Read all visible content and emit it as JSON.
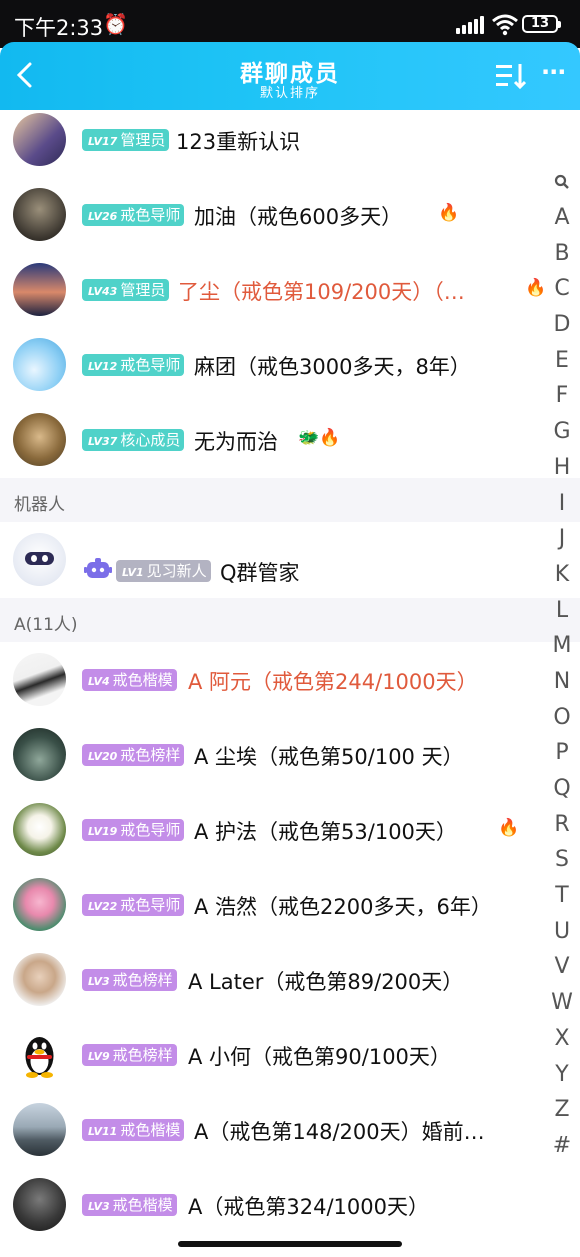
{
  "status_bar": {
    "time": "下午2:33",
    "battery": "13"
  },
  "header": {
    "back": "‹",
    "title": "群聊成员",
    "subtitle": "默认排序",
    "more": "···"
  },
  "sections": {
    "robot": "机器人",
    "a": "A(11人)"
  },
  "members": [
    {
      "level": "LV17",
      "role": "管理员",
      "name": "123重新认识",
      "emoji": ""
    },
    {
      "level": "LV26",
      "role": "戒色导师",
      "name": "加油（戒色600多天）",
      "emoji": "🔥"
    },
    {
      "level": "LV43",
      "role": "管理员",
      "name": "了尘（戒色第109/200天）（…",
      "emoji": "🔥"
    },
    {
      "level": "LV12",
      "role": "戒色导师",
      "name": "麻团（戒色3000多天，8年）",
      "emoji": ""
    },
    {
      "level": "LV37",
      "role": "核心成员",
      "name": "无为而治",
      "emoji": "🐲🔥"
    },
    {
      "level": "LV1",
      "role": "见习新人",
      "name": "Q群管家",
      "emoji": ""
    },
    {
      "level": "LV4",
      "role": "戒色楷模",
      "name": "A 阿元（戒色第244/1000天）",
      "emoji": ""
    },
    {
      "level": "LV20",
      "role": "戒色榜样",
      "name": "A 尘埃（戒色第50/100 天）",
      "emoji": ""
    },
    {
      "level": "LV19",
      "role": "戒色导师",
      "name": "A 护法（戒色第53/100天）",
      "emoji": "🔥"
    },
    {
      "level": "LV22",
      "role": "戒色导师",
      "name": "A 浩然（戒色2200多天，6年）",
      "emoji": ""
    },
    {
      "level": "LV3",
      "role": "戒色榜样",
      "name": "A Later（戒色第89/200天）",
      "emoji": ""
    },
    {
      "level": "LV9",
      "role": "戒色榜样",
      "name": "A 小何（戒色第90/100天）",
      "emoji": ""
    },
    {
      "level": "LV11",
      "role": "戒色楷模",
      "name": "A（戒色第148/200天）婚前…",
      "emoji": ""
    },
    {
      "level": "LV3",
      "role": "戒色楷模",
      "name": "A（戒色第324/1000天）",
      "emoji": ""
    }
  ],
  "index_letters": [
    "A",
    "B",
    "C",
    "D",
    "E",
    "F",
    "G",
    "H",
    "I",
    "J",
    "K",
    "L",
    "M",
    "N",
    "O",
    "P",
    "Q",
    "R",
    "S",
    "T",
    "U",
    "V",
    "W",
    "X",
    "Y",
    "Z",
    "#"
  ],
  "colors": {
    "header": "#1fc4f6",
    "badge_teal": "#4fd2c9",
    "badge_purple": "#c38de8",
    "badge_gray": "#b3b3c2",
    "name_red": "#e05a3c"
  }
}
